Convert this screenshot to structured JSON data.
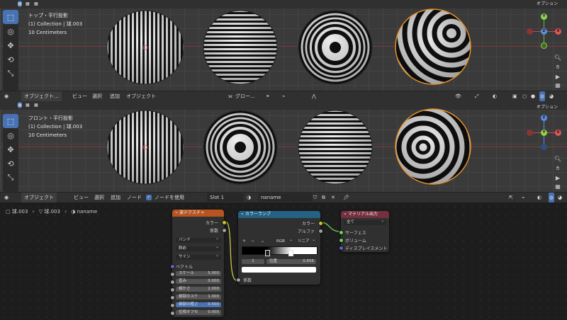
{
  "viewport_top": {
    "view_name": "トップ・平行投影",
    "collection": "(1) Collection | 球.003",
    "scale": "10 Centimeters",
    "options_label": "オプション"
  },
  "viewport_front": {
    "view_name": "フロント・平行投影",
    "collection": "(1) Collection | 球.003",
    "scale": "10 Centimeters",
    "options_label": "オプション"
  },
  "view3d_header": {
    "mode": "オブジェクト...",
    "menus": [
      "ビュー",
      "選択",
      "追加",
      "オブジェクト"
    ],
    "transform_orientation": "グロー..."
  },
  "gizmo_top": {
    "y": "Y",
    "z": "Z",
    "x": "X"
  },
  "gizmo_front": {
    "z": "Z",
    "y": "Y",
    "x": "X"
  },
  "node_header": {
    "mode": "オブジェクト",
    "menus": [
      "ビュー",
      "選択",
      "追加",
      "ノード"
    ],
    "use_nodes_label": "ノードを使用",
    "slot": "Slot 1",
    "material_name": "naname"
  },
  "breadcrumb": {
    "object": "球.003",
    "mesh": "球.003",
    "material": "naname"
  },
  "wave_texture": {
    "title": "波テクスチャ",
    "out_color": "カラー",
    "out_fac": "係数",
    "wave_type": "バンド",
    "direction": "斜め",
    "profile": "サイン",
    "vector_label": "ベクトル",
    "fields": [
      {
        "label": "スケール",
        "value": "5.000"
      },
      {
        "label": "歪み",
        "value": "0.000"
      },
      {
        "label": "細かさ",
        "value": "2.000"
      },
      {
        "label": "細部のスケ",
        "value": "1.000"
      },
      {
        "label": "細部の粗さ",
        "value": "0.500"
      },
      {
        "label": "位相オフセ",
        "value": "0.000"
      }
    ]
  },
  "color_ramp": {
    "title": "カラーランプ",
    "out_color": "カラー",
    "out_alpha": "アルファ",
    "plus": "+",
    "minus": "−",
    "color_mode": "RGB",
    "interpolation": "リニア",
    "index": "1",
    "pos_label": "位置",
    "pos_value": "0.656",
    "in_fac": "係数"
  },
  "material_output": {
    "title": "マテリアル出力",
    "target": "全て",
    "inputs": [
      "サーフェス",
      "ボリューム",
      "ディスプレイスメント"
    ]
  },
  "colors": {
    "accent_blue": "#4772b3",
    "wave_header": "#b7541f",
    "ramp_header": "#246283",
    "output_header": "#74303e",
    "selection_orange": "#e8902a",
    "link_yellow": "#c8c84a",
    "link_green": "#6bd158"
  }
}
